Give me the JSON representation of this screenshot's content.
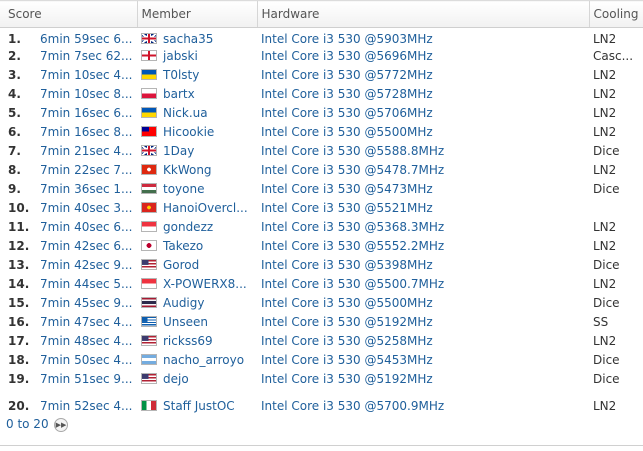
{
  "header": {
    "score": "Score",
    "member": "Member",
    "hardware": "Hardware",
    "cooling": "Cooling"
  },
  "rows": [
    {
      "rank": "1.",
      "score": "6min 59sec 6...",
      "flag": "uk",
      "member": "sacha35",
      "hardware": "Intel Core i3 530 @5903MHz",
      "cooling": "LN2"
    },
    {
      "rank": "2.",
      "score": "7min 7sec 62...",
      "flag": "england",
      "member": "jabski",
      "hardware": "Intel Core i3 530 @5696MHz",
      "cooling": "Casc..."
    },
    {
      "rank": "3.",
      "score": "7min 10sec 4...",
      "flag": "ukraine",
      "member": "T0lsty",
      "hardware": "Intel Core i3 530 @5772MHz",
      "cooling": "LN2"
    },
    {
      "rank": "4.",
      "score": "7min 10sec 8...",
      "flag": "poland",
      "member": "bartx",
      "hardware": "Intel Core i3 530 @5728MHz",
      "cooling": "LN2"
    },
    {
      "rank": "5.",
      "score": "7min 16sec 6...",
      "flag": "ukraine",
      "member": "Nick.ua",
      "hardware": "Intel Core i3 530 @5706MHz",
      "cooling": "LN2"
    },
    {
      "rank": "6.",
      "score": "7min 16sec 8...",
      "flag": "taiwan",
      "member": "Hicookie",
      "hardware": "Intel Core i3 530 @5500MHz",
      "cooling": "LN2"
    },
    {
      "rank": "7.",
      "score": "7min 21sec 4...",
      "flag": "uk",
      "member": "1Day",
      "hardware": "Intel Core i3 530 @5588.8MHz",
      "cooling": "Dice"
    },
    {
      "rank": "8.",
      "score": "7min 22sec 7...",
      "flag": "hongkong",
      "member": "KkWong",
      "hardware": "Intel Core i3 530 @5478.7MHz",
      "cooling": "LN2"
    },
    {
      "rank": "9.",
      "score": "7min 36sec 1...",
      "flag": "hungary",
      "member": "toyone",
      "hardware": "Intel Core i3 530 @5473MHz",
      "cooling": "Dice"
    },
    {
      "rank": "10.",
      "score": "7min 40sec 3...",
      "flag": "vietnam",
      "member": "HanoiOvercl...",
      "hardware": "Intel Core i3 530 @5521MHz",
      "cooling": ""
    },
    {
      "rank": "11.",
      "score": "7min 40sec 6...",
      "flag": "singapore",
      "member": "gondezz",
      "hardware": "Intel Core i3 530 @5368.3MHz",
      "cooling": "LN2"
    },
    {
      "rank": "12.",
      "score": "7min 42sec 6...",
      "flag": "japan",
      "member": "Takezo",
      "hardware": "Intel Core i3 530 @5552.2MHz",
      "cooling": "LN2"
    },
    {
      "rank": "13.",
      "score": "7min 42sec 9...",
      "flag": "usa",
      "member": "Gorod",
      "hardware": "Intel Core i3 530 @5398MHz",
      "cooling": "Dice"
    },
    {
      "rank": "14.",
      "score": "7min 44sec 5...",
      "flag": "singapore",
      "member": "X-POWERX8...",
      "hardware": "Intel Core i3 530 @5500.7MHz",
      "cooling": "LN2"
    },
    {
      "rank": "15.",
      "score": "7min 45sec 9...",
      "flag": "thailand",
      "member": "Audigy",
      "hardware": "Intel Core i3 530 @5500MHz",
      "cooling": "Dice"
    },
    {
      "rank": "16.",
      "score": "7min 47sec 4...",
      "flag": "greece",
      "member": "Unseen",
      "hardware": "Intel Core i3 530 @5192MHz",
      "cooling": "SS"
    },
    {
      "rank": "17.",
      "score": "7min 48sec 4...",
      "flag": "usa",
      "member": "rickss69",
      "hardware": "Intel Core i3 530 @5258MHz",
      "cooling": "LN2"
    },
    {
      "rank": "18.",
      "score": "7min 50sec 4...",
      "flag": "argentina",
      "member": "nacho_arroyo",
      "hardware": "Intel Core i3 530 @5453MHz",
      "cooling": "Dice"
    },
    {
      "rank": "19.",
      "score": "7min 51sec 9...",
      "flag": "usa",
      "member": "dejo",
      "hardware": "Intel Core i3 530 @5192MHz",
      "cooling": "Dice"
    },
    {
      "rank": "20.",
      "score": "7min 52sec 4...",
      "flag": "italy",
      "member": "Staff JustOC",
      "hardware": "Intel Core i3 530 @5700.9MHz",
      "cooling": "LN2"
    }
  ],
  "pager": {
    "range": "0 to 20",
    "next_icon": "double-chevron-right-icon"
  },
  "colors": {
    "link": "#1f5f9b",
    "text": "#333333",
    "rank": "#333333",
    "header_text": "#555555"
  }
}
